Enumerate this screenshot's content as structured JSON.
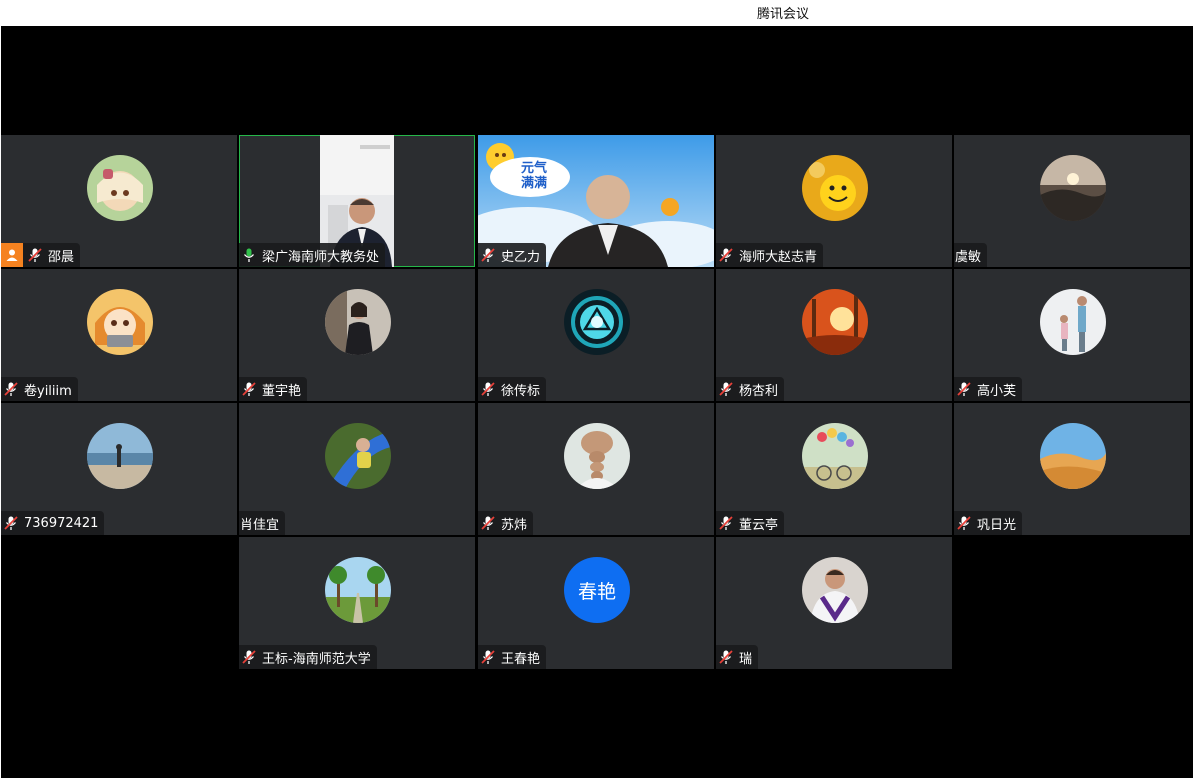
{
  "app": {
    "title": "腾讯会议"
  },
  "meeting": {
    "tiles": [
      {
        "name": "邵晨",
        "mic": "muted",
        "host": true,
        "avatar_icon": "anime-girl-icon"
      },
      {
        "name": "梁广海南师大教务处",
        "mic": "active",
        "host": false,
        "video": true
      },
      {
        "name": "史乙力",
        "mic": "muted",
        "host": false,
        "video": true
      },
      {
        "name": "海师大赵志青",
        "mic": "muted",
        "host": false,
        "avatar_icon": "smiley-face-icon"
      },
      {
        "name": "虞敏",
        "mic": "none",
        "host": false,
        "avatar_icon": "sunset-landscape-icon"
      },
      {
        "name": "卷yiliim",
        "mic": "muted",
        "host": false,
        "avatar_icon": "anime-girl-laptop-icon"
      },
      {
        "name": "董宇艳",
        "mic": "muted",
        "host": false,
        "avatar_icon": "person-portrait-icon"
      },
      {
        "name": "徐传标",
        "mic": "muted",
        "host": false,
        "avatar_icon": "arc-reactor-icon"
      },
      {
        "name": "杨杏利",
        "mic": "muted",
        "host": false,
        "avatar_icon": "autumn-forest-icon"
      },
      {
        "name": "高小芙",
        "mic": "muted",
        "host": false,
        "avatar_icon": "mother-child-icon"
      },
      {
        "name": "736972421",
        "mic": "muted",
        "host": false,
        "avatar_icon": "beach-person-icon"
      },
      {
        "name": "肖佳宜",
        "mic": "none",
        "host": false,
        "avatar_icon": "child-slide-icon"
      },
      {
        "name": "苏炜",
        "mic": "muted",
        "host": false,
        "avatar_icon": "braid-hair-icon"
      },
      {
        "name": "董云亭",
        "mic": "muted",
        "host": false,
        "avatar_icon": "balloons-bicycle-icon"
      },
      {
        "name": "巩日光",
        "mic": "muted",
        "host": false,
        "avatar_icon": "desert-dunes-icon"
      },
      {
        "name": "王标-海南师范大学",
        "mic": "muted",
        "host": false,
        "avatar_icon": "palm-road-icon"
      },
      {
        "name": "王春艳",
        "mic": "muted",
        "host": false,
        "avatar_text": "春艳"
      },
      {
        "name": "瑞",
        "mic": "muted",
        "host": false,
        "avatar_icon": "football-player-icon"
      }
    ],
    "video_overlay_text": [
      "元气",
      "满满"
    ]
  },
  "colors": {
    "tile_bg": "#2b2d30",
    "stage_bg": "#000000",
    "active_border": "#26b74a",
    "avatar_blue": "#0e6ef2",
    "host_orange": "#f58220"
  }
}
